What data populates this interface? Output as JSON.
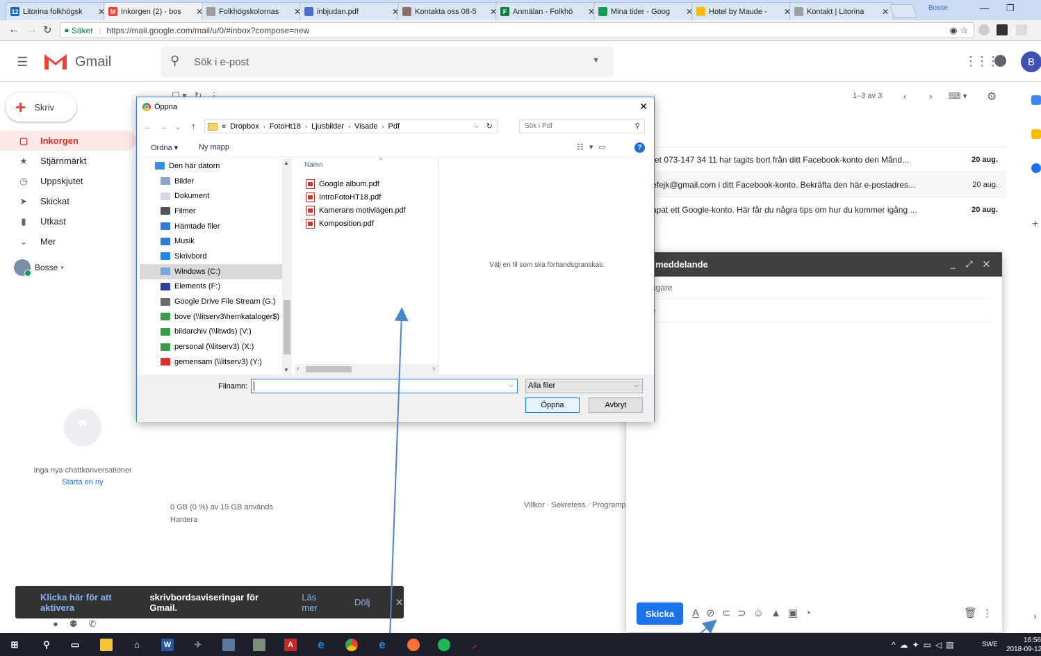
{
  "browser": {
    "tabs": [
      {
        "label": "Litorina folkhögsk",
        "icon_text": "12",
        "color": "#1565c0"
      },
      {
        "label": "Inkorgen (2) - bos",
        "icon_text": "M",
        "color": "#ea4335"
      },
      {
        "label": "Folkhögskolornas",
        "icon_text": "",
        "color": "#9e9e9e"
      },
      {
        "label": "inbjudan.pdf",
        "icon_text": "",
        "color": "#4a6fd1"
      },
      {
        "label": "Kontakta oss 08-5",
        "icon_text": "",
        "color": "#8d6e63"
      },
      {
        "label": "Anmälan - Folkhö",
        "icon_text": "F",
        "color": "#0f7d3f"
      },
      {
        "label": "Mina tider - Goog",
        "icon_text": "",
        "color": "#0f9d58"
      },
      {
        "label": "Hotel by Maude -",
        "icon_text": "",
        "color": "#fbbc05"
      },
      {
        "label": "Kontakt | Litorina",
        "icon_text": "",
        "color": "#9e9e9e"
      }
    ],
    "profile": "Bosse",
    "secure_label": "Säker",
    "url": "https://mail.google.com/mail/u/0/#inbox?compose=new"
  },
  "gmail": {
    "logo": "Gmail",
    "search_placeholder": "Sök i e-post",
    "avatar_letter": "B",
    "compose_label": "Skriv",
    "nav": [
      {
        "label": "Inkorgen",
        "icon": "inbox-icon",
        "glyph": "▢",
        "active": true
      },
      {
        "label": "Stjärnmärkt",
        "icon": "star-icon",
        "glyph": "★",
        "active": false
      },
      {
        "label": "Uppskjutet",
        "icon": "clock-icon",
        "glyph": "◷",
        "active": false
      },
      {
        "label": "Skickat",
        "icon": "send-icon",
        "glyph": "➤",
        "active": false
      },
      {
        "label": "Utkast",
        "icon": "draft-icon",
        "glyph": "▮",
        "active": false
      },
      {
        "label": "Mer",
        "icon": "chevron-down-icon",
        "glyph": "⌄",
        "active": false
      }
    ],
    "user_name": "Bosse",
    "chat_empty": "Inga nya chattkonversationer",
    "chat_start": "Starta en ny",
    "pager": "1–3 av 3",
    "mails": [
      {
        "snippet": "ret 073-147 34 11 har tagits bort från ditt Facebook-konto den Månd...",
        "date": "20 aug.",
        "unread": true
      },
      {
        "snippet": "efejk@gmail.com i ditt Facebook-konto. Bekräfta den här e-postadres...",
        "date": "20 aug.",
        "unread": false
      },
      {
        "snippet": "apat ett Google-konto. Här får du några tips om hur du kommer igång ...",
        "date": "20 aug.",
        "unread": true
      }
    ],
    "storage_line": "0 GB (0 %) av 15 GB används",
    "storage_manage": "Hantera",
    "footer_links": "Villkor · Sekretess · Programp"
  },
  "compose_window": {
    "title": "meddelande",
    "to_placeholder": "agare",
    "subject_placeholder": "e",
    "send_label": "Skicka"
  },
  "notification": {
    "link_text": "Klicka här för att aktivera",
    "text": "skrivbordsaviseringar för Gmail.",
    "more": "Läs mer",
    "hide": "Dölj"
  },
  "dialog": {
    "title": "Öppna",
    "breadcrumb": [
      "«",
      "Dropbox",
      "FotoHt18",
      "Ljusbilder",
      "Visade",
      "Pdf"
    ],
    "search_placeholder": "Sök i Pdf",
    "organize": "Ordna ▾",
    "new_folder": "Ny mapp",
    "tree": [
      {
        "label": "Den här datorn",
        "color": "#3b8ed8",
        "root": true,
        "selected": false
      },
      {
        "label": "Bilder",
        "color": "#8aa6c8",
        "root": false,
        "selected": false
      },
      {
        "label": "Dokument",
        "color": "#cfd8e3",
        "root": false,
        "selected": false
      },
      {
        "label": "Filmer",
        "color": "#555555",
        "root": false,
        "selected": false
      },
      {
        "label": "Hämtade filer",
        "color": "#2f7bd6",
        "root": false,
        "selected": false
      },
      {
        "label": "Musik",
        "color": "#2f7bd6",
        "root": false,
        "selected": false
      },
      {
        "label": "Skrivbord",
        "color": "#1e88e5",
        "root": false,
        "selected": false
      },
      {
        "label": "Windows (C:)",
        "color": "#7aa7d8",
        "root": false,
        "selected": true
      },
      {
        "label": "Elements (F:)",
        "color": "#2a3f9d",
        "root": false,
        "selected": false
      },
      {
        "label": "Google Drive File Stream (G:)",
        "color": "#6b6b6b",
        "root": false,
        "selected": false
      },
      {
        "label": "bove (\\\\litserv3\\hemkataloger$) (",
        "color": "#3a9c4a",
        "root": false,
        "selected": false
      },
      {
        "label": "bildarchiv (\\\\litwds) (V:)",
        "color": "#3a9c4a",
        "root": false,
        "selected": false
      },
      {
        "label": "personal (\\\\litserv3) (X:)",
        "color": "#3a9c4a",
        "root": false,
        "selected": false
      },
      {
        "label": "gemensam (\\\\litserv3) (Y:)",
        "color": "#d9322a",
        "root": false,
        "selected": false
      }
    ],
    "column_name": "Namn",
    "files": [
      "Google album.pdf",
      "IntroFotoHT18.pdf",
      "Kamerans motivlägen.pdf",
      "Komposition.pdf"
    ],
    "preview_text": "Välj en fil som ska förhandsgranskas.",
    "filename_label": "Filnamn:",
    "filename_value": "",
    "filter": "Alla filer",
    "open_label": "Öppna",
    "cancel_label": "Avbryt"
  },
  "taskbar": {
    "lang": "SWE",
    "time": "16:56",
    "date": "2018-09-12"
  }
}
